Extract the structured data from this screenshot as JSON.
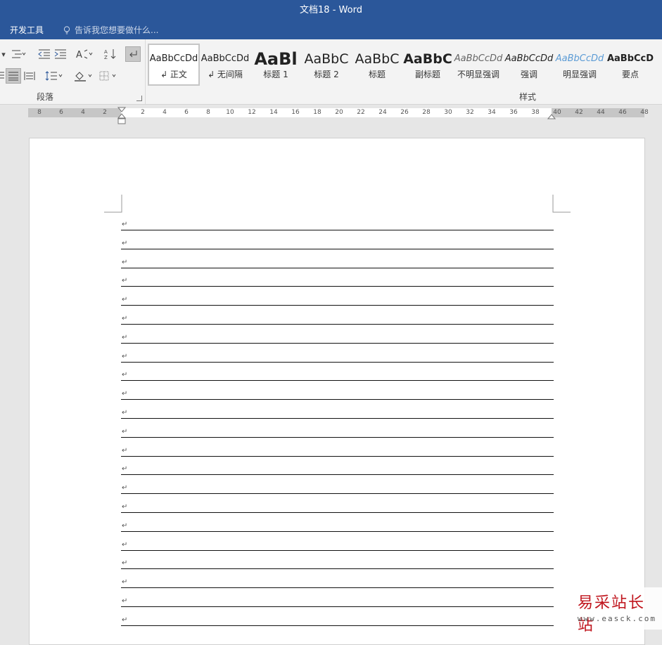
{
  "window": {
    "title": "文档18 - Word"
  },
  "ribbon": {
    "tab_developer": "开发工具",
    "tell_me_placeholder": "告诉我您想要做什么...",
    "paragraph_group_label": "段落",
    "styles_group_label": "样式",
    "styles": [
      {
        "sample": "AaBbCcDd",
        "name": "↲ 正文",
        "selected": true
      },
      {
        "sample": "AaBbCcDd",
        "name": "↲ 无间隔"
      },
      {
        "sample": "AaBl",
        "name": "标题 1"
      },
      {
        "sample": "AaBbC",
        "name": "标题 2"
      },
      {
        "sample": "AaBbC",
        "name": "标题"
      },
      {
        "sample": "AaBbC",
        "name": "副标题"
      },
      {
        "sample": "AaBbCcDd",
        "name": "不明显强调"
      },
      {
        "sample": "AaBbCcDd",
        "name": "强调"
      },
      {
        "sample": "AaBbCcDd",
        "name": "明显强调"
      },
      {
        "sample": "AaBbCcD",
        "name": "要点"
      }
    ]
  },
  "ruler": {
    "left_ticks": [
      "8",
      "6",
      "4",
      "2"
    ],
    "right_ticks": [
      "2",
      "4",
      "6",
      "8",
      "10",
      "12",
      "14",
      "16",
      "18",
      "20",
      "22",
      "24",
      "26",
      "28",
      "30",
      "32",
      "34",
      "36",
      "38",
      "40",
      "42",
      "44",
      "46",
      "48"
    ]
  },
  "document": {
    "paragraph_mark": "↵",
    "line_count": 22
  },
  "watermark": {
    "cn": "易采站长站",
    "en": "www.easck.com"
  },
  "colors": {
    "titlebar": "#2b579a",
    "ribbon": "#f3f3f3",
    "page": "#ffffff",
    "watermark_red": "#c0161e"
  }
}
